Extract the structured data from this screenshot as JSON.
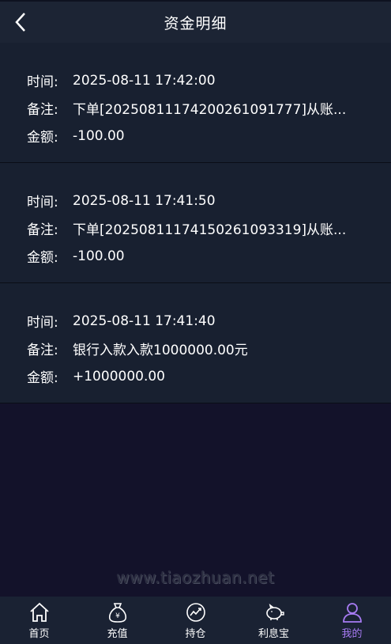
{
  "header": {
    "title": "资金明细"
  },
  "labels": {
    "time": "时间:",
    "note": "备注:",
    "amount": "金额:"
  },
  "records": [
    {
      "time": "2025-08-11 17:42:00",
      "note": "下单[20250811174200261091777]从账...",
      "amount": "-100.00"
    },
    {
      "time": "2025-08-11 17:41:50",
      "note": "下单[20250811174150261093319]从账...",
      "amount": "-100.00"
    },
    {
      "time": "2025-08-11 17:41:40",
      "note": "银行入款入款1000000.00元",
      "amount": "+1000000.00"
    }
  ],
  "watermark": "www.tiaozhuan.net",
  "tabbar": {
    "items": [
      {
        "label": "首页",
        "icon": "home-icon"
      },
      {
        "label": "充值",
        "icon": "money-bag-icon"
      },
      {
        "label": "持仓",
        "icon": "chart-icon"
      },
      {
        "label": "利息宝",
        "icon": "piggy-bank-icon"
      },
      {
        "label": "我的",
        "icon": "user-icon"
      }
    ],
    "active_index": 4
  },
  "colors": {
    "active": "#a77bf3",
    "header_bg": "#1c2434",
    "record_bg": "#182030",
    "page_bg": "#13122a"
  }
}
